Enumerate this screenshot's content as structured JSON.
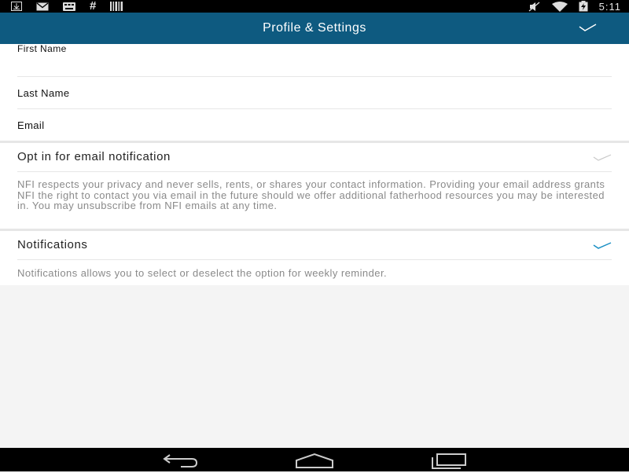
{
  "status_bar": {
    "time": "5:11",
    "left_icons": [
      "download-icon",
      "gmail-icon",
      "keyboard-icon",
      "hash-icon",
      "barcode-icon"
    ],
    "right_icons": [
      "mute-icon",
      "wifi-icon",
      "battery-charging-icon"
    ]
  },
  "app_bar": {
    "title": "Profile & Settings",
    "action_icon": "check-icon"
  },
  "profile": {
    "first_name_label": "First Name",
    "last_name_label": "Last Name",
    "email_label": "Email"
  },
  "email_opt_in": {
    "label": "Opt in for email notification",
    "checked": false,
    "description": "NFI respects your privacy and never sells, rents, or shares your contact information. Providing your email address grants NFI the right to contact you via email in the future should we offer additional fatherhood resources you may be interested in. You may unsubscribe from NFI emails at any time."
  },
  "notifications": {
    "label": "Notifications",
    "checked": true,
    "description": "Notifications allows you to select or deselect the option for weekly reminder."
  },
  "colors": {
    "app_bar": "#0e5a80",
    "accent": "#1a8fc4",
    "unchecked": "#c8c8c8"
  },
  "nav_bar": {
    "icons": [
      "back-icon",
      "home-icon",
      "recents-icon"
    ]
  }
}
